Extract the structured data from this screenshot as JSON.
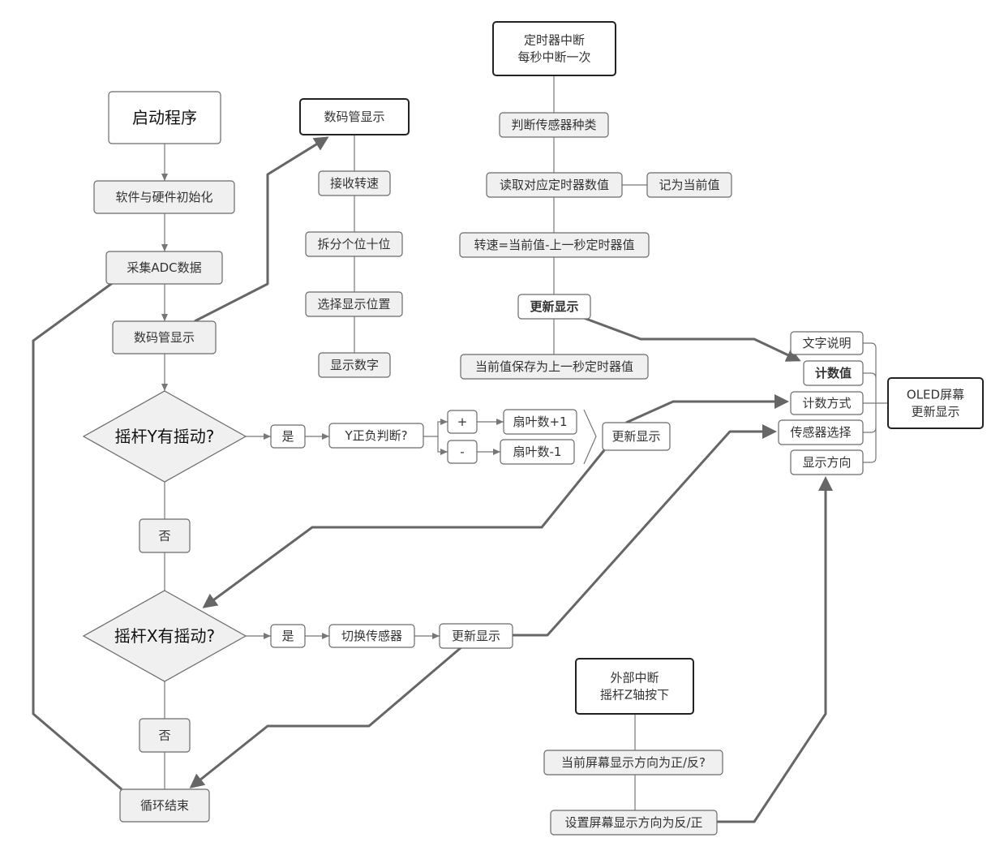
{
  "nodes": {
    "start": {
      "lines": [
        "启动程序"
      ]
    },
    "init": {
      "lines": [
        "软件与硬件初始化"
      ]
    },
    "adc": {
      "lines": [
        "采集ADC数据"
      ]
    },
    "seg": {
      "lines": [
        "数码管显示"
      ]
    },
    "diamond_y": {
      "lines": [
        "摇杆Y有摇动?"
      ]
    },
    "yes_y": {
      "lines": [
        "是"
      ]
    },
    "y_sign": {
      "lines": [
        "Y正负判断?"
      ]
    },
    "plus": {
      "lines": [
        "+"
      ]
    },
    "minus": {
      "lines": [
        "-"
      ]
    },
    "fan_plus": {
      "lines": [
        "扇叶数+1"
      ]
    },
    "fan_minus": {
      "lines": [
        "扇叶数-1"
      ]
    },
    "update_y": {
      "lines": [
        "更新显示"
      ]
    },
    "no_y": {
      "lines": [
        "否"
      ]
    },
    "diamond_x": {
      "lines": [
        "摇杆X有摇动?"
      ]
    },
    "yes_x": {
      "lines": [
        "是"
      ]
    },
    "switch_sensor": {
      "lines": [
        "切换传感器"
      ]
    },
    "update_x": {
      "lines": [
        "更新显示"
      ]
    },
    "no_x": {
      "lines": [
        "否"
      ]
    },
    "loop_end": {
      "lines": [
        "循环结束"
      ]
    },
    "seg_title": {
      "lines": [
        "数码管显示"
      ]
    },
    "recv_speed": {
      "lines": [
        "接收转速"
      ]
    },
    "split_digits": {
      "lines": [
        "拆分个位十位"
      ]
    },
    "select_pos": {
      "lines": [
        "选择显示位置"
      ]
    },
    "show_digit": {
      "lines": [
        "显示数字"
      ]
    },
    "timer": {
      "lines": [
        "定时器中断",
        "每秒中断一次"
      ]
    },
    "judge_sensor": {
      "lines": [
        "判断传感器种类"
      ]
    },
    "read_timer": {
      "lines": [
        "读取对应定时器数值"
      ]
    },
    "record_current": {
      "lines": [
        "记为当前值"
      ]
    },
    "speed_calc": {
      "lines": [
        "转速=当前值-上一秒定时器值"
      ]
    },
    "update_timer": {
      "lines": [
        "更新显示"
      ]
    },
    "save_prev": {
      "lines": [
        "当前值保存为上一秒定时器值"
      ]
    },
    "text_desc": {
      "lines": [
        "文字说明"
      ]
    },
    "count_value": {
      "lines": [
        "计数值"
      ]
    },
    "count_mode": {
      "lines": [
        "计数方式"
      ]
    },
    "sensor_select": {
      "lines": [
        "传感器选择"
      ]
    },
    "display_dir": {
      "lines": [
        "显示方向"
      ]
    },
    "oled": {
      "lines": [
        "OLED屏幕",
        "更新显示"
      ]
    },
    "ext_int": {
      "lines": [
        "外部中断",
        "摇杆Z轴按下"
      ]
    },
    "cur_dir": {
      "lines": [
        "当前屏幕显示方向为正/反?"
      ]
    },
    "set_dir": {
      "lines": [
        "设置屏幕显示方向为反/正"
      ]
    }
  },
  "colors": {
    "box_fill": "#f0f0f0",
    "border": "#6a6a6a",
    "arrow": "#666666"
  }
}
